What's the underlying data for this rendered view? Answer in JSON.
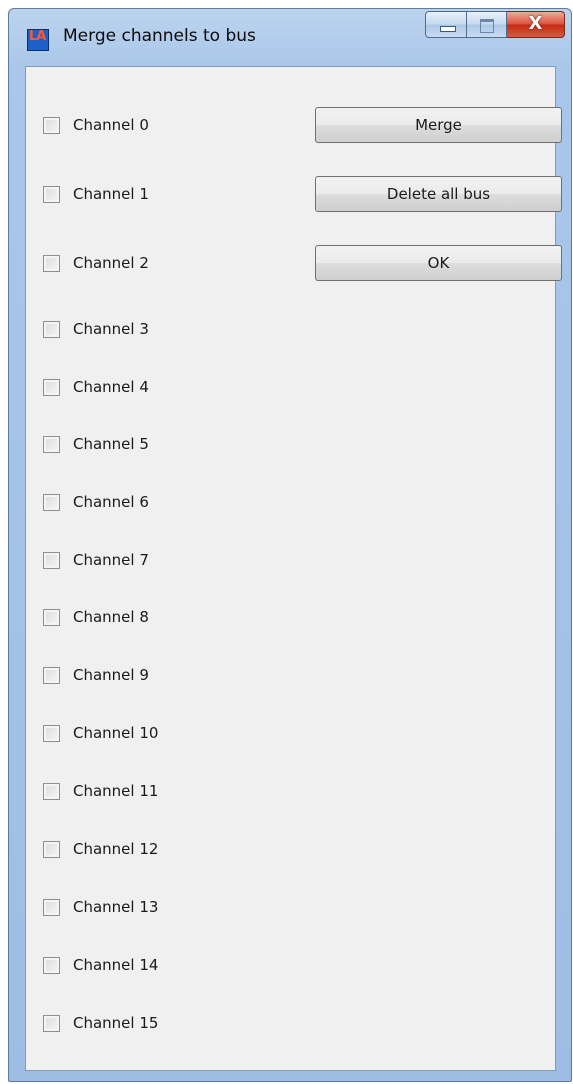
{
  "window": {
    "title": "Merge channels to bus",
    "app_icon_text": "LA"
  },
  "caption_buttons": {
    "close_glyph": "X"
  },
  "buttons": {
    "merge_label": "Merge",
    "delete_all_bus_label": "Delete all bus",
    "ok_label": "OK"
  },
  "channels": [
    {
      "label": "Channel 0",
      "checked": false
    },
    {
      "label": "Channel 1",
      "checked": false
    },
    {
      "label": "Channel 2",
      "checked": false
    },
    {
      "label": "Channel 3",
      "checked": false
    },
    {
      "label": "Channel 4",
      "checked": false
    },
    {
      "label": "Channel 5",
      "checked": false
    },
    {
      "label": "Channel 6",
      "checked": false
    },
    {
      "label": "Channel 7",
      "checked": false
    },
    {
      "label": "Channel 8",
      "checked": false
    },
    {
      "label": "Channel 9",
      "checked": false
    },
    {
      "label": "Channel 10",
      "checked": false
    },
    {
      "label": "Channel 11",
      "checked": false
    },
    {
      "label": "Channel 12",
      "checked": false
    },
    {
      "label": "Channel 13",
      "checked": false
    },
    {
      "label": "Channel 14",
      "checked": false
    },
    {
      "label": "Channel 15",
      "checked": false
    }
  ]
}
